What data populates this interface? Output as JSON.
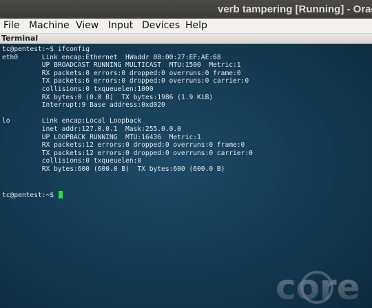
{
  "window": {
    "title": "verb tampering [Running] - Oracl"
  },
  "menubar": {
    "items": [
      "File",
      "Machine",
      "View",
      "Input",
      "Devices",
      "Help"
    ]
  },
  "terminal": {
    "header": "Terminal",
    "output": "tc@pentest:~$ ifconfig\neth0      Link encap:Ethernet  HWaddr 08:00:27:EF:AE:68\n          UP BROADCAST RUNNING MULTICAST  MTU:1500  Metric:1\n          RX packets:0 errors:0 dropped:0 overruns:0 frame:0\n          TX packets:6 errors:0 dropped:0 overruns:0 carrier:0\n          collisions:0 txqueuelen:1000\n          RX bytes:0 (0.0 B)  TX bytes:1986 (1.9 KiB)\n          Interrupt:9 Base address:0xd020\n\nlo        Link encap:Local Loopback\n          inet addr:127.0.0.1  Mask:255.0.0.0\n          UP LOOPBACK RUNNING  MTU:16436  Metric:1\n          RX packets:12 errors:0 dropped:0 overruns:0 frame:0\n          TX packets:12 errors:0 dropped:0 overruns:0 carrier:0\n          collisions:0 txqueuelen:0\n          RX bytes:600 (600.0 B)  TX bytes:600 (600.0 B)",
    "prompt": "tc@pentest:~$ ",
    "cursor_color": "#20e03a"
  },
  "logo": {
    "text": "core",
    "icon": "core-linux-logo"
  },
  "colors": {
    "terminal_bg": "#133a52",
    "text": "#e8e8e8",
    "titlebar_bg": "#3b3b38"
  }
}
